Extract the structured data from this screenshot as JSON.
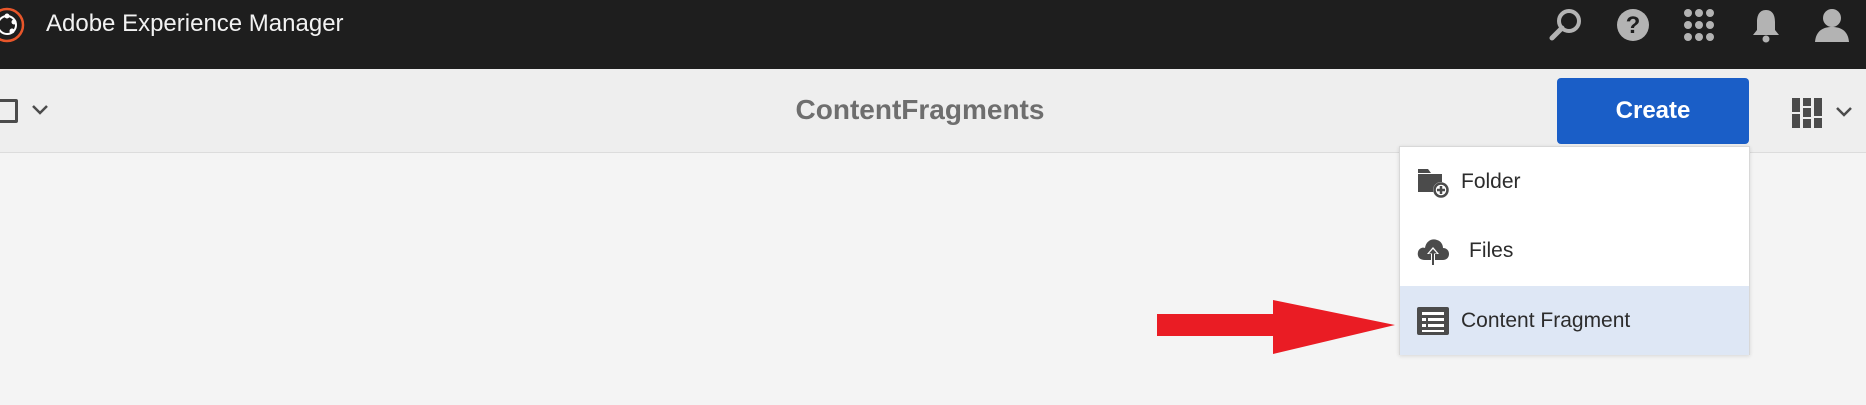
{
  "topbar": {
    "app_title": "Adobe Experience Manager",
    "icons": [
      "search-icon",
      "help-icon",
      "solutions-icon",
      "notifications-icon",
      "user-icon"
    ]
  },
  "actionbar": {
    "page_title": "ContentFragments",
    "create_label": "Create"
  },
  "create_menu": {
    "items": [
      {
        "label": "Folder",
        "icon": "folder-add-icon",
        "selected": false
      },
      {
        "label": "Files",
        "icon": "upload-cloud-icon",
        "selected": false
      },
      {
        "label": "Content Fragment",
        "icon": "content-fragment-icon",
        "selected": true
      }
    ]
  },
  "colors": {
    "topbar_bg": "#1e1e1e",
    "accent": "#1a5ec7",
    "selected_bg": "#dee7f5",
    "annotation_arrow": "#ea1c24"
  }
}
